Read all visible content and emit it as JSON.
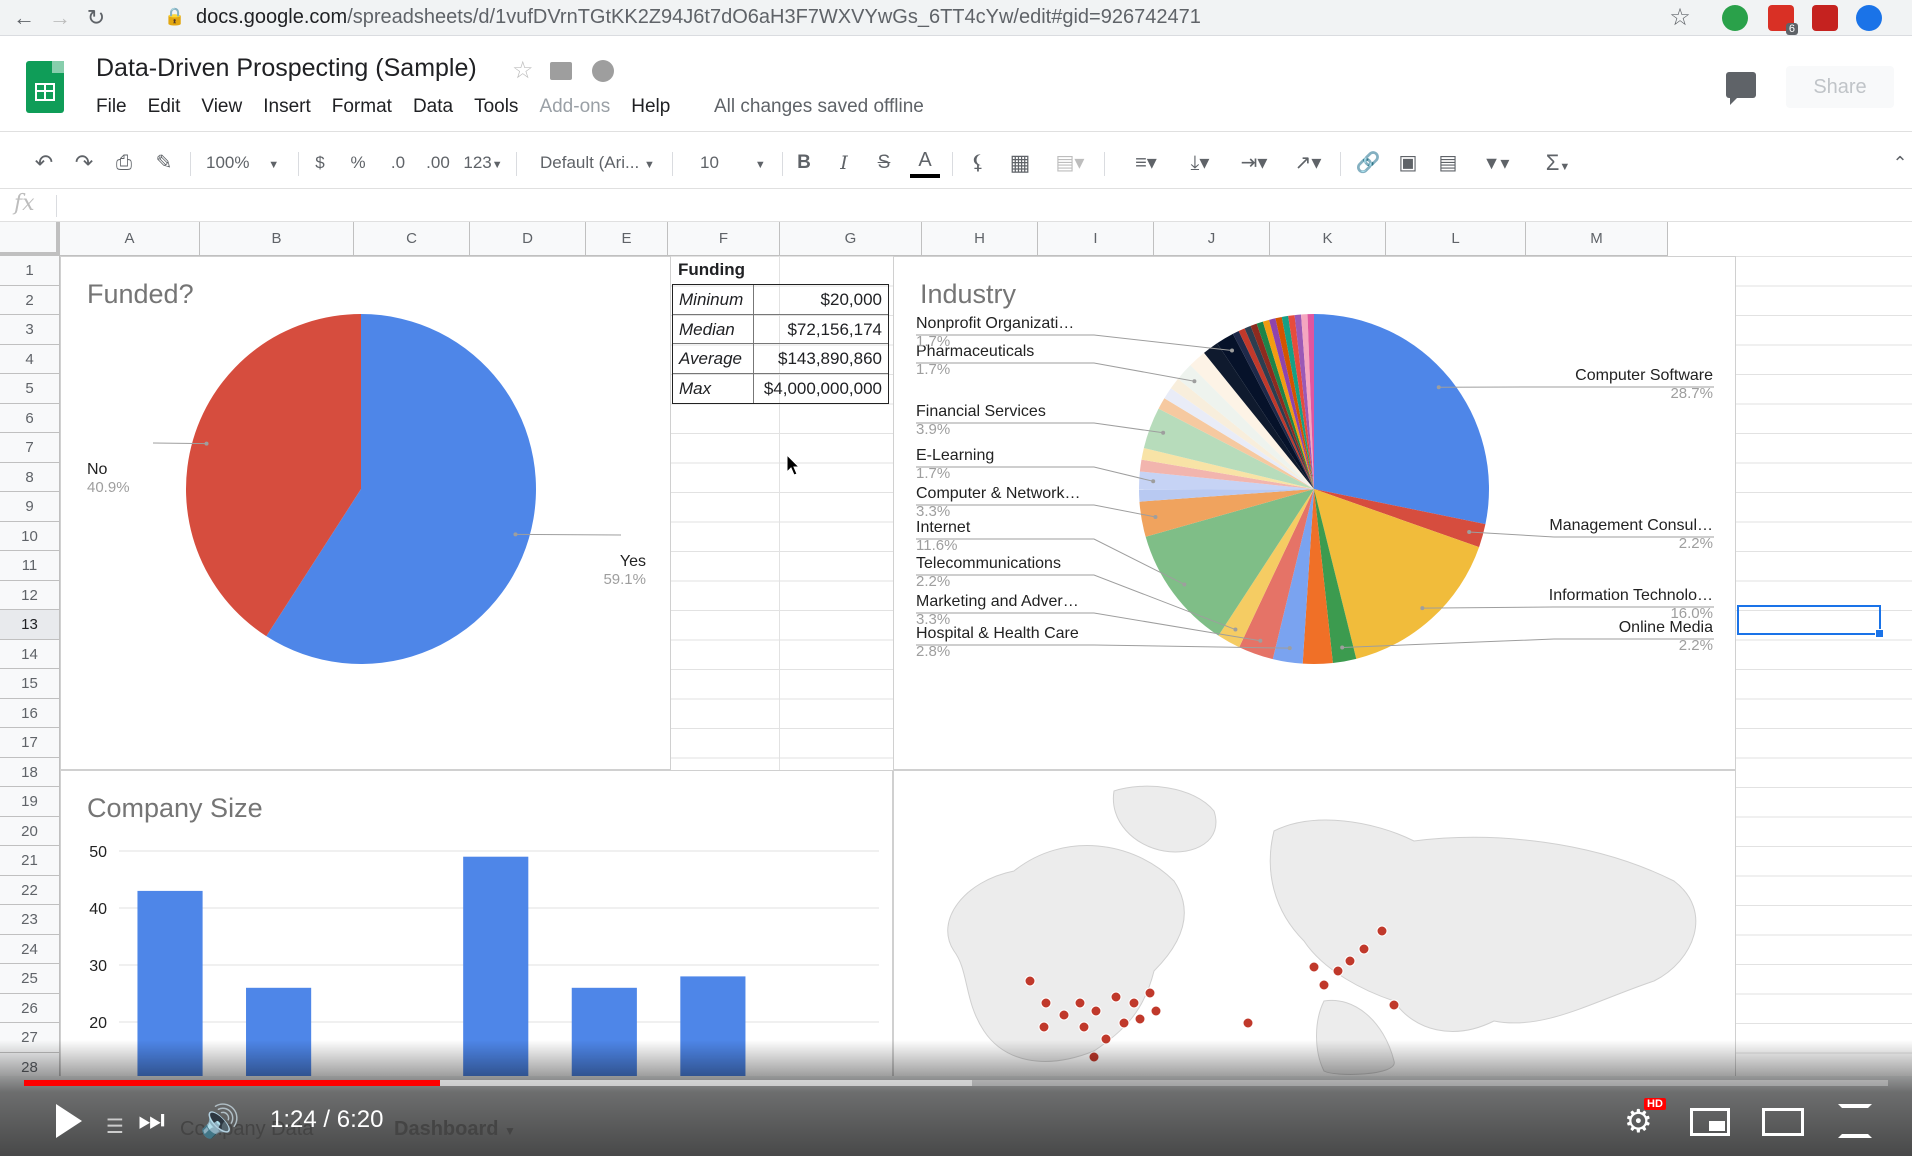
{
  "browser": {
    "url_host": "docs.google.com",
    "url_path": "/spreadsheets/d/1vufDVrnTGtKK2Z94J6t7dO6aH3F7WXVYwGs_6TT4cYw/edit#gid=926742471",
    "ext_badge": "6"
  },
  "doc": {
    "title": "Data-Driven Prospecting (Sample)",
    "menus": [
      "File",
      "Edit",
      "View",
      "Insert",
      "Format",
      "Data",
      "Tools",
      "Add-ons",
      "Help"
    ],
    "save_status": "All changes saved offline",
    "share_label": "Share"
  },
  "toolbar": {
    "zoom": "100%",
    "currency": "$",
    "percent": "%",
    "decrease_decimal": ".0",
    "increase_decimal": ".00",
    "more_formats": "123",
    "font": "Default (Ari...",
    "font_size": "10",
    "bold": "B",
    "italic": "I",
    "strike": "S",
    "text_color": "A",
    "functions": "Σ"
  },
  "formula_bar": {
    "fx": "fx",
    "value": ""
  },
  "grid": {
    "columns": [
      "A",
      "B",
      "C",
      "D",
      "E",
      "F",
      "G",
      "H",
      "I",
      "J",
      "K",
      "L",
      "M"
    ],
    "rows": [
      "1",
      "2",
      "3",
      "4",
      "5",
      "6",
      "7",
      "8",
      "9",
      "10",
      "11",
      "12",
      "13",
      "14",
      "15",
      "16",
      "17",
      "18",
      "19",
      "20",
      "21",
      "22",
      "23",
      "24",
      "25",
      "26",
      "27",
      "28"
    ],
    "selected_row": "13"
  },
  "funding": {
    "title": "Funding",
    "rows": [
      {
        "name": "Mininum",
        "value": "$20,000"
      },
      {
        "name": "Median",
        "value": "$72,156,174"
      },
      {
        "name": "Average",
        "value": "$143,890,860"
      },
      {
        "name": "Max",
        "value": "$4,000,000,000"
      }
    ]
  },
  "chart_data": [
    {
      "type": "pie",
      "title": "Funded?",
      "slices": [
        {
          "label": "Yes",
          "value": 59.1,
          "pct_label": "59.1%",
          "color": "#4e86e8"
        },
        {
          "label": "No",
          "value": 40.9,
          "pct_label": "40.9%",
          "color": "#d64d3e"
        }
      ]
    },
    {
      "type": "pie",
      "title": "Industry",
      "slices": [
        {
          "label": "Computer Software",
          "value": 28.7,
          "pct_label": "28.7%",
          "color": "#4e86e8"
        },
        {
          "label": "Management Consul…",
          "value": 2.2,
          "pct_label": "2.2%",
          "color": "#d64d3e"
        },
        {
          "label": "Information Technolo…",
          "value": 16.0,
          "pct_label": "16.0%",
          "color": "#f1bc3b"
        },
        {
          "label": "Online Media",
          "value": 2.2,
          "pct_label": "2.2%",
          "color": "#3c9b4f"
        },
        {
          "label": "",
          "value": 2.8,
          "pct_label": "",
          "color": "#f07027"
        },
        {
          "label": "Hospital & Health Care",
          "value": 2.8,
          "pct_label": "2.8%",
          "color": "#7aa3f0"
        },
        {
          "label": "Marketing and Adver…",
          "value": 3.3,
          "pct_label": "3.3%",
          "color": "#e57367"
        },
        {
          "label": "Telecommunications",
          "value": 2.2,
          "pct_label": "2.2%",
          "color": "#f5cc63"
        },
        {
          "label": "Internet",
          "value": 11.6,
          "pct_label": "11.6%",
          "color": "#7fbe87"
        },
        {
          "label": "Computer & Network…",
          "value": 3.3,
          "pct_label": "3.3%",
          "color": "#f0a35e"
        },
        {
          "label": "",
          "value": 1.1,
          "pct_label": "",
          "color": "#b8c9f2"
        },
        {
          "label": "E-Learning",
          "value": 1.7,
          "pct_label": "1.7%",
          "color": "#c6d3f5"
        },
        {
          "label": "",
          "value": 1.1,
          "pct_label": "",
          "color": "#f2b5ae"
        },
        {
          "label": "",
          "value": 1.1,
          "pct_label": "",
          "color": "#f8e3a6"
        },
        {
          "label": "Financial Services",
          "value": 3.9,
          "pct_label": "3.9%",
          "color": "#b7dcbb"
        },
        {
          "label": "",
          "value": 1.1,
          "pct_label": "",
          "color": "#f6c9a0"
        },
        {
          "label": "",
          "value": 1.1,
          "pct_label": "",
          "color": "#e9ecf7"
        },
        {
          "label": "",
          "value": 1.1,
          "pct_label": "",
          "color": "#f8eedc"
        },
        {
          "label": "Pharmaceuticals",
          "value": 1.7,
          "pct_label": "1.7%",
          "color": "#eef3ee"
        },
        {
          "label": "",
          "value": 1.7,
          "pct_label": "",
          "color": "#fdf3e6"
        },
        {
          "label": "",
          "value": 1.5,
          "pct_label": "",
          "color": "#0f1a2e"
        },
        {
          "label": "Nonprofit Organizati…",
          "value": 1.7,
          "pct_label": "1.7%",
          "color": "#06122a"
        },
        {
          "label": "",
          "value": 0.6,
          "pct_label": "",
          "color": "#1f2a4a"
        },
        {
          "label": "",
          "value": 0.6,
          "pct_label": "",
          "color": "#c0392b"
        },
        {
          "label": "",
          "value": 0.6,
          "pct_label": "",
          "color": "#2c3e50"
        },
        {
          "label": "",
          "value": 0.6,
          "pct_label": "",
          "color": "#8e2b1f"
        },
        {
          "label": "",
          "value": 0.6,
          "pct_label": "",
          "color": "#1e8449"
        },
        {
          "label": "",
          "value": 0.6,
          "pct_label": "",
          "color": "#f39c12"
        },
        {
          "label": "",
          "value": 0.6,
          "pct_label": "",
          "color": "#8e44ad"
        },
        {
          "label": "",
          "value": 0.6,
          "pct_label": "",
          "color": "#d35400"
        },
        {
          "label": "",
          "value": 0.6,
          "pct_label": "",
          "color": "#16a085"
        },
        {
          "label": "",
          "value": 0.6,
          "pct_label": "",
          "color": "#e74c3c"
        },
        {
          "label": "",
          "value": 0.6,
          "pct_label": "",
          "color": "#9b59b6"
        },
        {
          "label": "",
          "value": 0.6,
          "pct_label": "",
          "color": "#f4a6c0"
        },
        {
          "label": "",
          "value": 0.6,
          "pct_label": "",
          "color": "#e056a0"
        }
      ]
    },
    {
      "type": "bar",
      "title": "Company Size",
      "categories": [
        "",
        "",
        "",
        "",
        "",
        "",
        ""
      ],
      "values": [
        43,
        26,
        0,
        49,
        26,
        28,
        0
      ],
      "yticks": [
        "50",
        "40",
        "30",
        "20"
      ],
      "ylim": [
        20,
        50
      ],
      "color": "#4e86e8"
    }
  ],
  "map": {
    "dot_color": "#c0392b"
  },
  "sheet_tabs": [
    "Company Data",
    "Dashboard"
  ],
  "video": {
    "time": "1:24 / 6:20",
    "played_fraction": 0.224,
    "buffered_fraction": 0.51,
    "hd_badge": "HD"
  }
}
